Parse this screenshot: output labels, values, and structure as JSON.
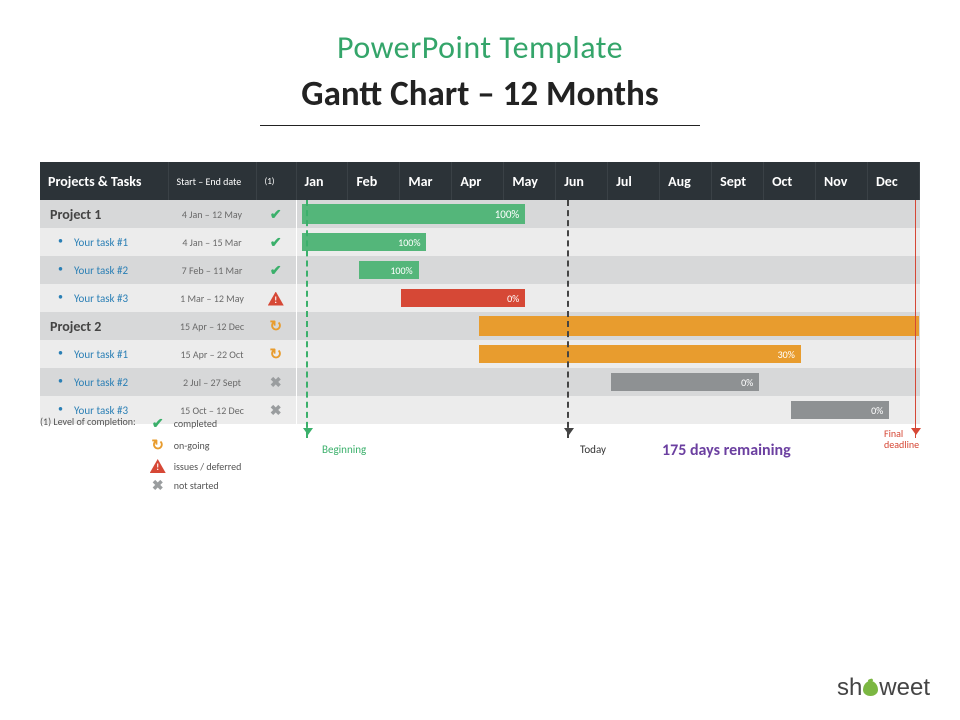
{
  "supertitle": "PowerPoint Template",
  "title": "Gantt Chart – 12 Months",
  "header": {
    "projects": "Projects & Tasks",
    "dates": "Start – End date",
    "note": "(1)",
    "months": [
      "Jan",
      "Feb",
      "Mar",
      "Apr",
      "May",
      "Jun",
      "Jul",
      "Aug",
      "Sept",
      "Oct",
      "Nov",
      "Dec"
    ]
  },
  "rows": [
    {
      "name": "Project 1",
      "dates": "4 Jan – 12  May",
      "status": "check",
      "type": "project"
    },
    {
      "name": "Your task #1",
      "dates": "4 Jan – 15 Mar",
      "status": "check",
      "type": "task"
    },
    {
      "name": "Your task #2",
      "dates": "7 Feb – 11 Mar",
      "status": "check",
      "type": "task"
    },
    {
      "name": "Your task #3",
      "dates": "1 Mar – 12 May",
      "status": "warn",
      "type": "task"
    },
    {
      "name": "Project 2",
      "dates": "15 Apr – 12 Dec",
      "status": "spin",
      "type": "project"
    },
    {
      "name": "Your task #1",
      "dates": "15 Apr – 22 Oct",
      "status": "spin",
      "type": "task"
    },
    {
      "name": "Your task #2",
      "dates": "2 Jul – 27 Sept",
      "status": "cross",
      "type": "task"
    },
    {
      "name": "Your task #3",
      "dates": "15 Oct – 12 Dec",
      "status": "cross",
      "type": "task"
    }
  ],
  "bars": [
    {
      "row": 0,
      "start": 0.1,
      "end": 4.4,
      "color": "green",
      "label": "100%",
      "proj": true
    },
    {
      "row": 1,
      "start": 0.1,
      "end": 2.5,
      "color": "green",
      "label": "100%"
    },
    {
      "row": 2,
      "start": 1.2,
      "end": 2.35,
      "color": "green",
      "label": "100%"
    },
    {
      "row": 3,
      "start": 2.0,
      "end": 4.4,
      "color": "red",
      "label": "0%"
    },
    {
      "row": 4,
      "start": 3.5,
      "end": 11.98,
      "color": "orange",
      "label": "",
      "proj": true
    },
    {
      "row": 5,
      "start": 3.5,
      "end": 9.7,
      "color": "orange",
      "label": "30%"
    },
    {
      "row": 6,
      "start": 6.05,
      "end": 8.9,
      "color": "grey",
      "label": "0%"
    },
    {
      "row": 7,
      "start": 9.5,
      "end": 11.4,
      "color": "grey",
      "label": "0%"
    }
  ],
  "markers": {
    "beginning": "Beginning",
    "today": "Today",
    "final": "Final deadline"
  },
  "remaining": "175 days remaining",
  "legend": {
    "title": "(1) Level of completion:",
    "items": [
      {
        "icon": "check",
        "label": "completed"
      },
      {
        "icon": "spin",
        "label": "on-going"
      },
      {
        "icon": "warn",
        "label": "issues / deferred"
      },
      {
        "icon": "cross",
        "label": "not started"
      }
    ]
  },
  "brand": {
    "pre": "sh",
    "post": "weet"
  },
  "chart_data": {
    "type": "gantt",
    "title": "Gantt Chart – 12 Months",
    "x_unit": "month",
    "categories": [
      "Jan",
      "Feb",
      "Mar",
      "Apr",
      "May",
      "Jun",
      "Jul",
      "Aug",
      "Sept",
      "Oct",
      "Nov",
      "Dec"
    ],
    "markers": {
      "Beginning": "Jan",
      "Today": "Jul",
      "Final deadline": "Dec"
    },
    "days_remaining": 175,
    "series": [
      {
        "name": "Project 1",
        "level": "project",
        "start": "4 Jan",
        "end": "12 May",
        "completion_pct": 100,
        "status": "completed"
      },
      {
        "name": "Project 1 / Your task #1",
        "level": "task",
        "start": "4 Jan",
        "end": "15 Mar",
        "completion_pct": 100,
        "status": "completed"
      },
      {
        "name": "Project 1 / Your task #2",
        "level": "task",
        "start": "7 Feb",
        "end": "11 Mar",
        "completion_pct": 100,
        "status": "completed"
      },
      {
        "name": "Project 1 / Your task #3",
        "level": "task",
        "start": "1 Mar",
        "end": "12 May",
        "completion_pct": 0,
        "status": "issues / deferred"
      },
      {
        "name": "Project 2",
        "level": "project",
        "start": "15 Apr",
        "end": "12 Dec",
        "completion_pct": null,
        "status": "on-going"
      },
      {
        "name": "Project 2 / Your task #1",
        "level": "task",
        "start": "15 Apr",
        "end": "22 Oct",
        "completion_pct": 30,
        "status": "on-going"
      },
      {
        "name": "Project 2 / Your task #2",
        "level": "task",
        "start": "2 Jul",
        "end": "27 Sept",
        "completion_pct": 0,
        "status": "not started"
      },
      {
        "name": "Project 2 / Your task #3",
        "level": "task",
        "start": "15 Oct",
        "end": "12 Dec",
        "completion_pct": 0,
        "status": "not started"
      }
    ]
  }
}
